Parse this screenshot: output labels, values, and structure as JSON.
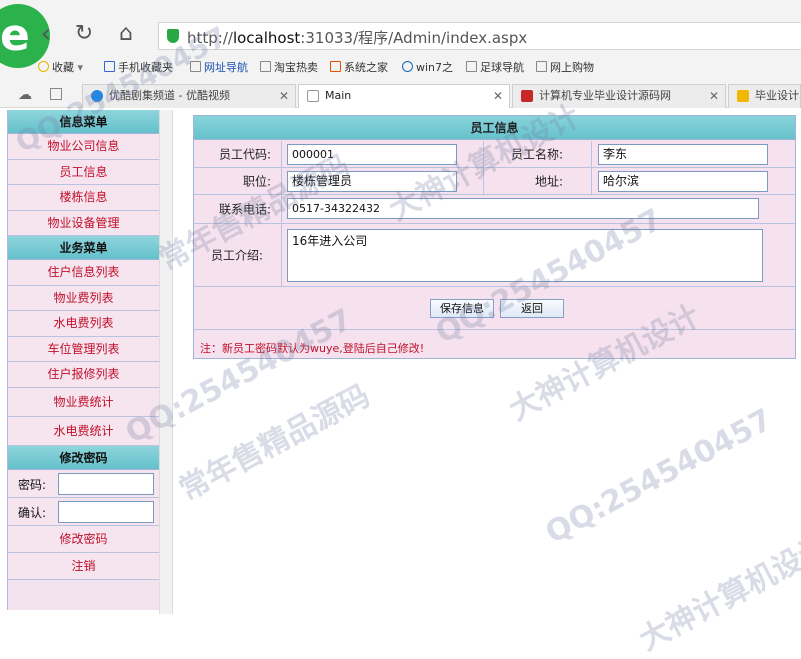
{
  "browser": {
    "url_prefix": "http://",
    "url_host": "localhost",
    "url_rest": ":31033/程序/Admin/index.aspx",
    "bookmarks": [
      {
        "label": "收藏",
        "icon": "star-icon"
      },
      {
        "label": "手机收藏夹",
        "icon": "phone-icon"
      },
      {
        "label": "网址导航",
        "icon": "page-icon"
      },
      {
        "label": "淘宝热卖",
        "icon": "page-icon"
      },
      {
        "label": "系统之家",
        "icon": "windows-icon"
      },
      {
        "label": "win7之",
        "icon": "bird-icon"
      },
      {
        "label": "足球导航",
        "icon": "page-icon"
      },
      {
        "label": "网上购物",
        "icon": "page-icon"
      }
    ],
    "tabs": [
      {
        "label": "优酷剧集频道 - 优酷视频",
        "icon_color": "#1e88e5"
      },
      {
        "label": "Main",
        "icon_color": "#cccccc"
      },
      {
        "label": "计算机专业毕业设计源码网",
        "icon_color": "#c62828"
      },
      {
        "label": "毕业设计",
        "icon_color": "#f2b705"
      }
    ]
  },
  "menu": {
    "sections": [
      {
        "title": "信息菜单",
        "items": [
          "物业公司信息",
          "员工信息",
          "楼栋信息",
          "物业设备管理"
        ]
      },
      {
        "title": "业务菜单",
        "items": [
          "住户信息列表",
          "物业费列表",
          "水电费列表",
          "车位管理列表",
          "住户报修列表",
          "物业费统计",
          "水电费统计"
        ]
      },
      {
        "title": "修改密码"
      }
    ],
    "password_label": "密码:",
    "confirm_label": "确认:",
    "change_password_button": "修改密码",
    "logout_button": "注销"
  },
  "form": {
    "title": "员工信息",
    "code_label": "员工代码:",
    "code_value": "000001",
    "name_label": "员工名称:",
    "name_value": "李东",
    "position_label": "职位:",
    "position_value": "楼栋管理员",
    "address_label": "地址:",
    "address_value": "哈尔滨",
    "phone_label": "联系电话:",
    "phone_value": "0517-34322432",
    "intro_label": "员工介绍:",
    "intro_value": "16年进入公司",
    "save_button": "保存信息",
    "back_button": "返回",
    "note": "注：新员工密码默认为wuye,登陆后自己修改!"
  },
  "watermark": [
    "QQ:254540457",
    "大神计算机设计",
    "常年售精品源码"
  ],
  "colors": {
    "header_cyan": "#66c2cc",
    "menu_red": "#c0102a",
    "panel_pink": "#f6e2ee"
  }
}
